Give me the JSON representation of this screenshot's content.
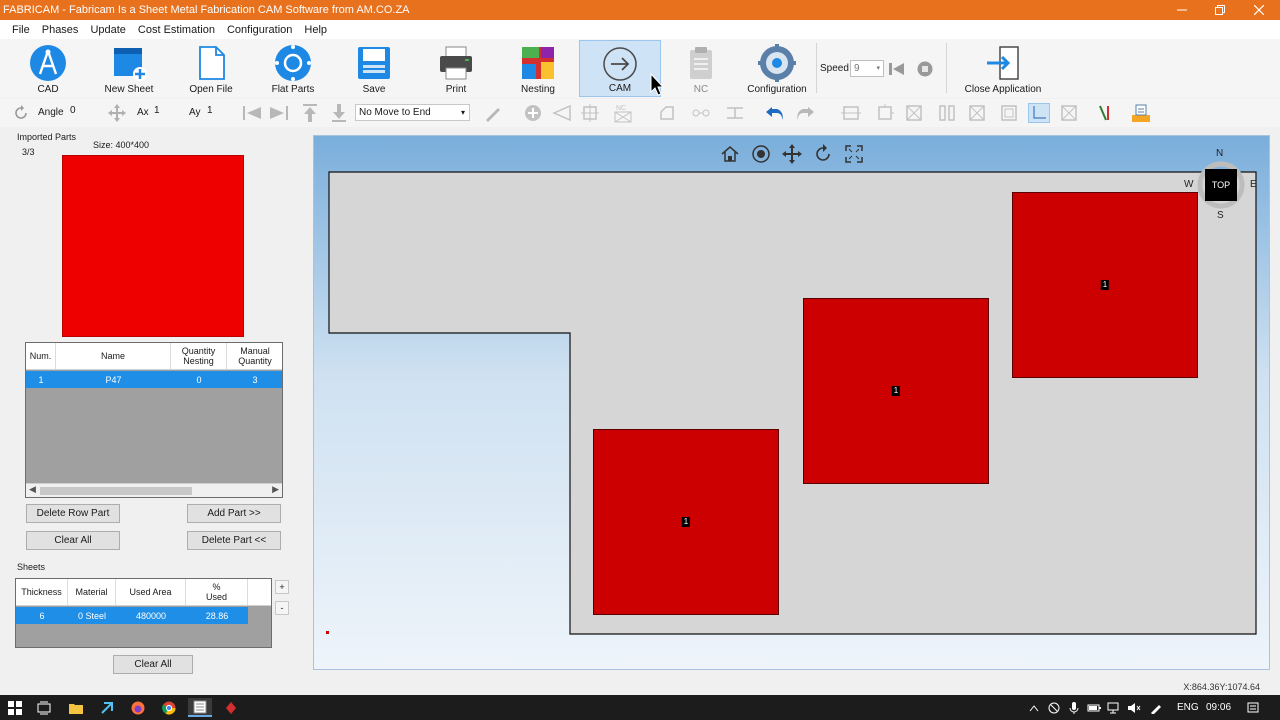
{
  "window": {
    "title": "FABRICAM - Fabricam Is a Sheet Metal Fabrication CAM Software from AM.CO.ZA",
    "title_bar_color": "#e8711e"
  },
  "menu": [
    "File",
    "Phases",
    "Update",
    "Cost Estimation",
    "Configuration",
    "Help"
  ],
  "ribbon": {
    "buttons": [
      {
        "label": "CAD",
        "icon": "compass-drafting-icon"
      },
      {
        "label": "New Sheet",
        "icon": "new-sheet-icon"
      },
      {
        "label": "Open File",
        "icon": "open-file-icon"
      },
      {
        "label": "Flat Parts",
        "icon": "flat-parts-icon"
      },
      {
        "label": "Save",
        "icon": "save-icon"
      },
      {
        "label": "Print",
        "icon": "printer-icon"
      },
      {
        "label": "Nesting",
        "icon": "nesting-icon"
      },
      {
        "label": "CAM",
        "icon": "cam-arrow-icon",
        "active": true
      },
      {
        "label": "NC",
        "icon": "clipboard-icon",
        "disabled": true
      },
      {
        "label": "Configuration",
        "icon": "gear-icon"
      },
      {
        "label": "Close Application",
        "icon": "exit-icon"
      }
    ],
    "speed_label": "Speed",
    "speed_value": "9"
  },
  "toolbar2": {
    "angle_label": "Angle",
    "angle_value": "0",
    "ax_label": "Ax",
    "ax_value": "1",
    "ay_label": "Ay",
    "ay_value": "1",
    "move_mode": "No Move to End"
  },
  "left_panel": {
    "imported_parts_label": "Imported Parts",
    "count": "3/3",
    "size_label": "Size: 400*400",
    "preview_color": "#ee0000",
    "parts_table": {
      "headers": [
        "Num.",
        "Name",
        "Quantity Nesting",
        "Manual Quantity"
      ],
      "rows": [
        [
          "1",
          "P47",
          "0",
          "3"
        ]
      ]
    },
    "buttons": {
      "delete_row_part": "Delete Row Part",
      "add_part": "Add Part >>",
      "clear_all": "Clear All",
      "delete_part": "Delete Part <<"
    },
    "sheets_label": "Sheets",
    "sheets_table": {
      "headers": [
        "Thickness",
        "Material",
        "Used Area",
        "% Used"
      ],
      "rows": [
        [
          "6",
          "0  Steel",
          "480000",
          "28.86"
        ]
      ]
    },
    "sheets_buttons": {
      "plus": "+",
      "minus": "-",
      "clear_all": "Clear All"
    }
  },
  "canvas": {
    "compass": {
      "n": "N",
      "s": "S",
      "w": "W",
      "e": "E",
      "view": "TOP"
    },
    "part_labels": [
      "1",
      "1",
      "1"
    ],
    "part_color": "#cc0000",
    "sheet_color": "#d6d6d6"
  },
  "status": {
    "coords": "X:864.36Y:1074.64"
  },
  "taskbar": {
    "lang": "ENG",
    "time": "09:06"
  }
}
